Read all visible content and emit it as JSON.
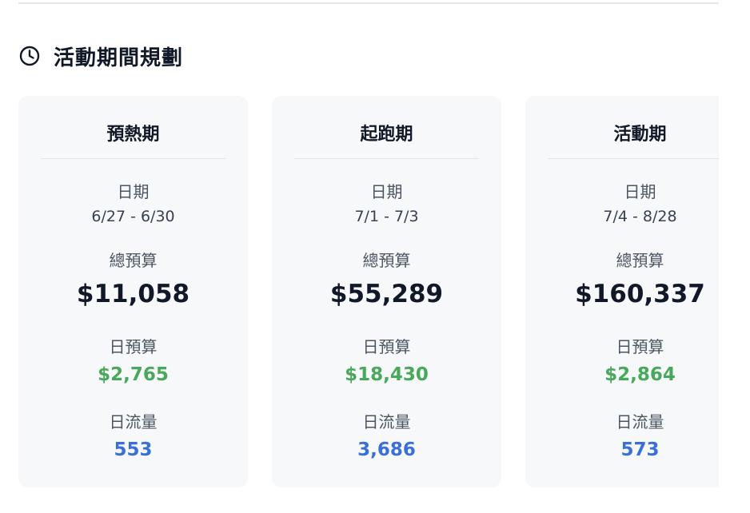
{
  "section": {
    "title": "活動期間規劃",
    "icon": "clock-icon"
  },
  "labels": {
    "date": "日期",
    "total_budget": "總預算",
    "daily_budget": "日預算",
    "daily_traffic": "日流量"
  },
  "colors": {
    "daily_budget": "#48a85b",
    "daily_traffic": "#3b6fd8",
    "card_bg": "#f7f8fa"
  },
  "phases": [
    {
      "name": "預熱期",
      "date_range": "6/27 - 6/30",
      "total_budget": "$11,058",
      "daily_budget": "$2,765",
      "daily_traffic": "553"
    },
    {
      "name": "起跑期",
      "date_range": "7/1 - 7/3",
      "total_budget": "$55,289",
      "daily_budget": "$18,430",
      "daily_traffic": "3,686"
    },
    {
      "name": "活動期",
      "date_range": "7/4 - 8/28",
      "total_budget": "$160,337",
      "daily_budget": "$2,864",
      "daily_traffic": "573"
    }
  ]
}
